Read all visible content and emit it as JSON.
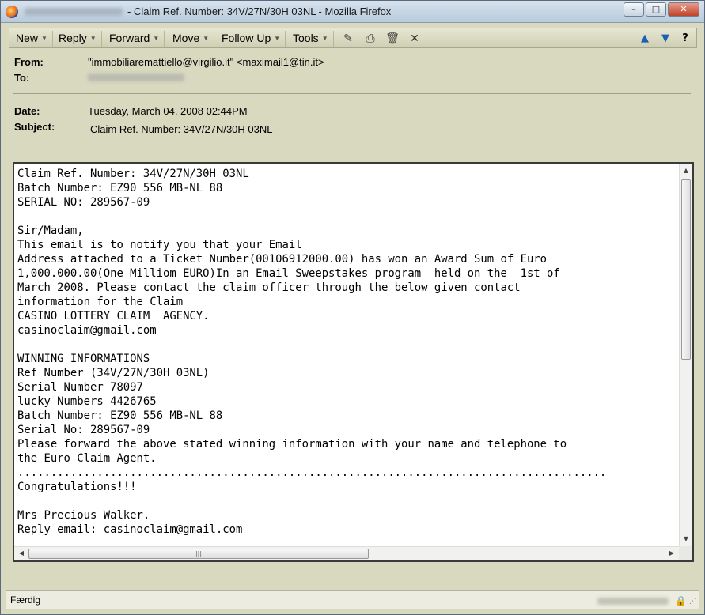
{
  "window": {
    "title": "- Claim Ref. Number: 34V/27N/30H 03NL - Mozilla Firefox",
    "controls": {
      "minimize": "–",
      "maximize": "□",
      "close": "✕"
    }
  },
  "toolbar": {
    "new_label": "New",
    "reply_label": "Reply",
    "forward_label": "Forward",
    "move_label": "Move",
    "followup_label": "Follow Up",
    "tools_label": "Tools",
    "icons": [
      "edit-icon",
      "print-icon",
      "trash-icon",
      "close-icon",
      "arrow-up-icon",
      "arrow-down-icon",
      "help-icon"
    ]
  },
  "header": {
    "from_label": "From:",
    "from_value": "\"immobiliaremattiello@virgilio.it\" <maximail1@tin.it>",
    "to_label": "To:",
    "date_label": "Date:",
    "date_value": "Tuesday, March 04, 2008 02:44PM",
    "subject_label": "Subject:",
    "subject_value": "Claim Ref. Number: 34V/27N/30H 03NL"
  },
  "message": {
    "body": "Claim Ref. Number: 34V/27N/30H 03NL\nBatch Number: EZ90 556 MB-NL 88\nSERIAL NO: 289567-09\n\nSir/Madam,\nThis email is to notify you that your Email\nAddress attached to a Ticket Number(00106912000.00) has won an Award Sum of Euro\n1,000.000.00(One Milliom EURO)In an Email Sweepstakes program  held on the  1st of\nMarch 2008. Please contact the claim officer through the below given contact\ninformation for the Claim\nCASINO LOTTERY CLAIM  AGENCY.\ncasinoclaim@gmail.com\n\nWINNING INFORMATIONS\nRef Number (34V/27N/30H 03NL)\nSerial Number 78097\nlucky Numbers 4426765\nBatch Number: EZ90 556 MB-NL 88\nSerial No: 289567-09\nPlease forward the above stated winning information with your name and telephone to\nthe Euro Claim Agent.\n.........................................................................................\nCongratulations!!!\n\nMrs Precious Walker.\nReply email: casinoclaim@gmail.com"
  },
  "statusbar": {
    "status_text": "Færdig"
  }
}
